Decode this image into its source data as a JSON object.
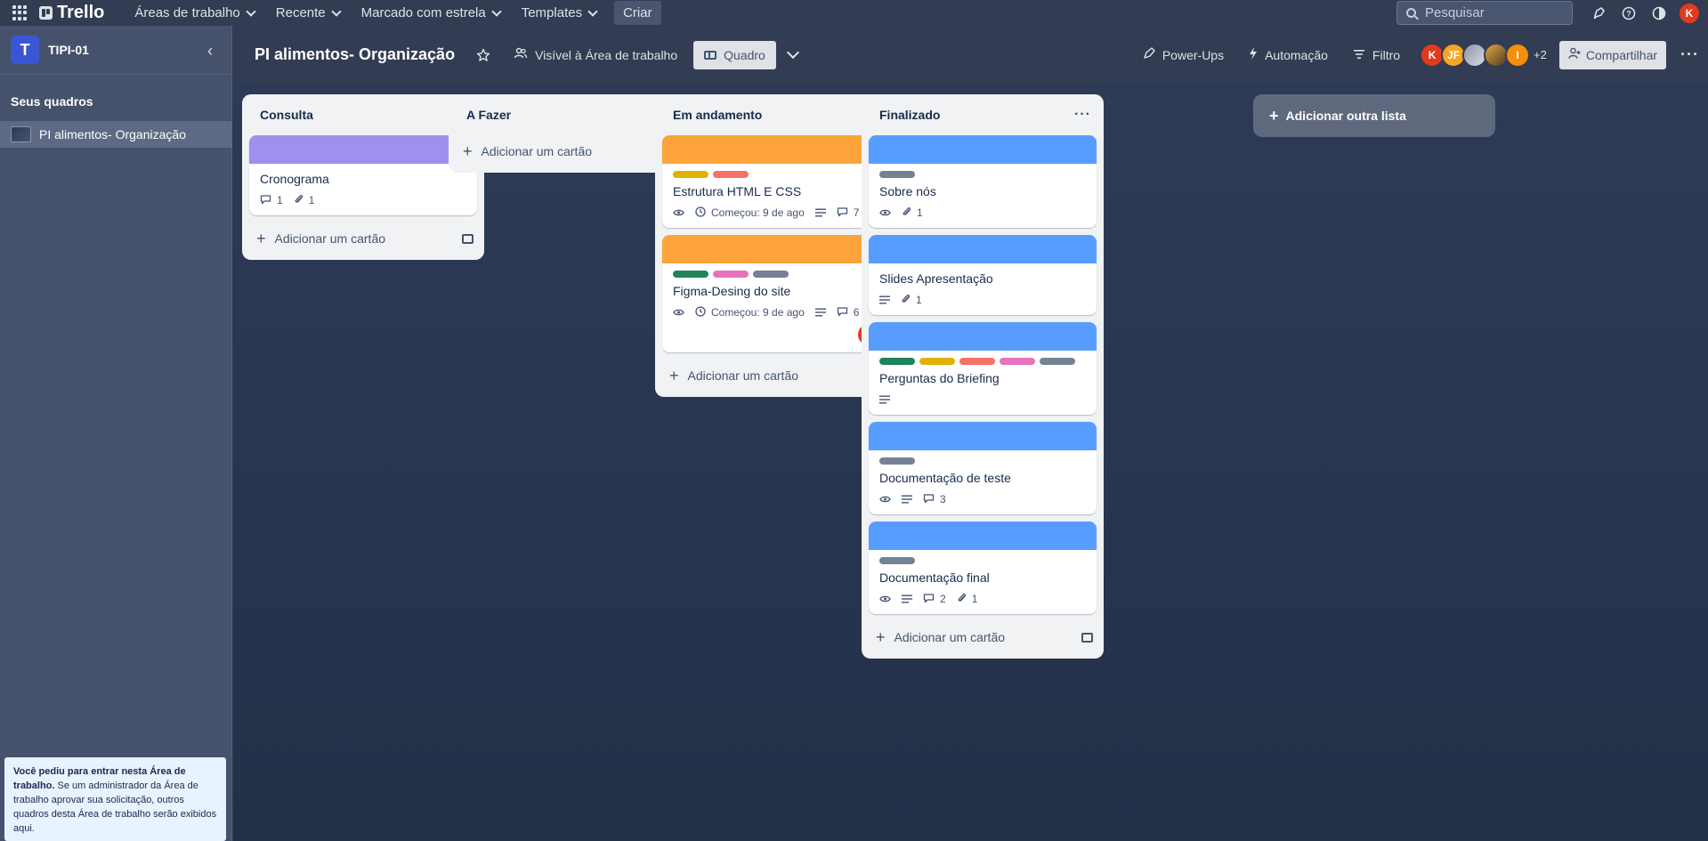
{
  "topbar": {
    "app_name": "Trello",
    "menu": [
      {
        "label": "Áreas de trabalho"
      },
      {
        "label": "Recente"
      },
      {
        "label": "Marcado com estrela"
      },
      {
        "label": "Templates"
      }
    ],
    "create_label": "Criar",
    "search_placeholder": "Pesquisar",
    "user_initial": "K"
  },
  "sidebar": {
    "workspace_initial": "T",
    "workspace_name": "TIPI-01",
    "section_title": "Seus quadros",
    "board_name": "PI alimentos- Organização",
    "notice_bold": "Você pediu para entrar nesta Área de trabalho.",
    "notice_text": " Se um administrador da Área de trabalho aprovar sua solicitação, outros quadros desta Área de trabalho serão exibidos aqui."
  },
  "board": {
    "title": "PI alimentos- Organização",
    "visibility": "Visível à Área de trabalho",
    "view": "Quadro",
    "powerups": "Power-Ups",
    "automation": "Automação",
    "filter": "Filtro",
    "members": [
      "K",
      "JF",
      "",
      "",
      "I"
    ],
    "more_members": "+2",
    "share": "Compartilhar"
  },
  "colors": {
    "purple": "#9f8fef",
    "orange": "#fca43a",
    "blue": "#579dff",
    "yellow": "#e2b203",
    "red": "#f87168",
    "green": "#1f845a",
    "pink": "#e774bb",
    "gray": "#758195"
  },
  "lists": [
    {
      "title": "Consulta",
      "add_card": "Adicionar um cartão",
      "cards": [
        {
          "title": "Cronograma",
          "cover": "purple",
          "labels": [],
          "comments": "1",
          "attachments": "1"
        }
      ]
    },
    {
      "title": "A Fazer",
      "add_card": "Adicionar um cartão",
      "cards": []
    },
    {
      "title": "Em andamento",
      "add_card": "Adicionar um cartão",
      "cards": [
        {
          "title": "Estrutura HTML E CSS",
          "cover": "orange",
          "labels": [
            "yellow",
            "red"
          ],
          "watch": true,
          "start": "Começou: 9 de ago",
          "description": true,
          "comments": "7"
        },
        {
          "title": "Figma-Desing do site",
          "cover": "orange",
          "labels": [
            "green",
            "pink",
            "gray"
          ],
          "watch": true,
          "start": "Começou: 9 de ago",
          "description": true,
          "comments": "6",
          "member": "K"
        }
      ]
    },
    {
      "title": "Finalizado",
      "add_card": "Adicionar um cartão",
      "cards": [
        {
          "title": "Sobre nós",
          "cover": "blue",
          "labels": [
            "gray"
          ],
          "watch": true,
          "attachments": "1"
        },
        {
          "title": "Slides Apresentação",
          "cover": "blue",
          "labels": [],
          "description": true,
          "attachments": "1"
        },
        {
          "title": "Perguntas do Briefing",
          "cover": "blue",
          "labels": [
            "green",
            "yellow",
            "red",
            "pink",
            "gray"
          ],
          "description": true
        },
        {
          "title": "Documentação de teste",
          "cover": "blue",
          "labels": [
            "gray"
          ],
          "watch": true,
          "description": true,
          "comments": "3"
        },
        {
          "title": "Documentação final",
          "cover": "blue",
          "labels": [
            "gray"
          ],
          "watch": true,
          "description": true,
          "comments": "2",
          "attachments": "1"
        }
      ]
    }
  ],
  "add_list": "Adicionar outra lista"
}
